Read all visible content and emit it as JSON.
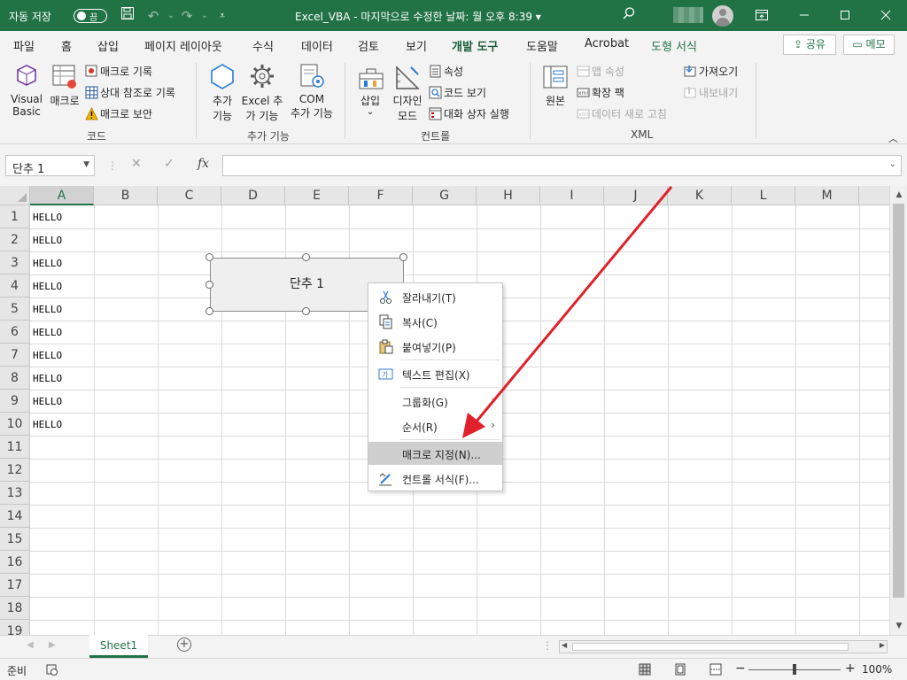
{
  "titlebar": {
    "autosave_label": "자동 저장",
    "autosave_state": "끔",
    "document_title": "Excel_VBA  -  마지막으로 수정한 날짜: 월 오후 8:39  ▾"
  },
  "tabs": [
    "파일",
    "홈",
    "삽입",
    "페이지 레이아웃",
    "수식",
    "데이터",
    "검토",
    "보기",
    "개발 도구",
    "도움말",
    "Acrobat",
    "도형 서식"
  ],
  "active_tab": "개발 도구",
  "share_label": "공유",
  "memo_label": "메모",
  "ribbon": {
    "code": {
      "visual_basic": [
        "Visual",
        "Basic"
      ],
      "macro": "매크로",
      "record_macro": "매크로 기록",
      "relative_ref": "상대 참조로 기록",
      "macro_security": "매크로 보안",
      "group": "코드"
    },
    "addins": {
      "addins": [
        "추가",
        "기능"
      ],
      "excel_addins": [
        "Excel 추",
        "가 기능"
      ],
      "com_addins": [
        "COM",
        "추가 기능"
      ],
      "group": "추가 기능"
    },
    "controls": {
      "insert": [
        "삽입",
        "⌄"
      ],
      "design_mode": [
        "디자인",
        "모드"
      ],
      "properties": "속성",
      "view_code": "코드 보기",
      "run_dialog": "대화 상자 실행",
      "group": "컨트롤"
    },
    "xml": {
      "source": "원본",
      "map_properties": "맵 속성",
      "expansion_packs": "확장 팩",
      "refresh_data": "데이터 새로 고침",
      "import": "가져오기",
      "export": "내보내기",
      "group": "XML"
    }
  },
  "formula_bar": {
    "name_box": "단추 1",
    "cancel": "✕",
    "enter": "✓",
    "fx": "fx",
    "content": ""
  },
  "grid": {
    "columns": [
      "A",
      "B",
      "C",
      "D",
      "E",
      "F",
      "G",
      "H",
      "I",
      "J",
      "K",
      "L",
      "M"
    ],
    "rows": [
      "1",
      "2",
      "3",
      "4",
      "5",
      "6",
      "7",
      "8",
      "9",
      "10",
      "11",
      "12",
      "13",
      "14",
      "15",
      "16",
      "17",
      "18",
      "19"
    ],
    "cells_A": [
      "HELLO",
      "HELLO",
      "HELLO",
      "HELLO",
      "HELLO",
      "HELLO",
      "HELLO",
      "HELLO",
      "HELLO",
      "HELLO"
    ]
  },
  "button_shape": {
    "label": "단추 1"
  },
  "context_menu": {
    "cut": "잘라내기(T)",
    "copy": "복사(C)",
    "paste": "붙여넣기(P)",
    "edit_text": "텍스트 편집(X)",
    "group": "그룹화(G)",
    "order": "순서(R)",
    "assign_macro": "매크로 지정(N)...",
    "format_control": "컨트롤 서식(F)...",
    "highlighted": "매크로 지정(N)..."
  },
  "sheet_tabs": [
    "Sheet1"
  ],
  "statusbar": {
    "ready": "준비",
    "zoom": "100%",
    "zoom_minus": "−",
    "zoom_plus": "+"
  },
  "colors": {
    "excel_green": "#217346",
    "annotation_red": "#e0202a"
  }
}
